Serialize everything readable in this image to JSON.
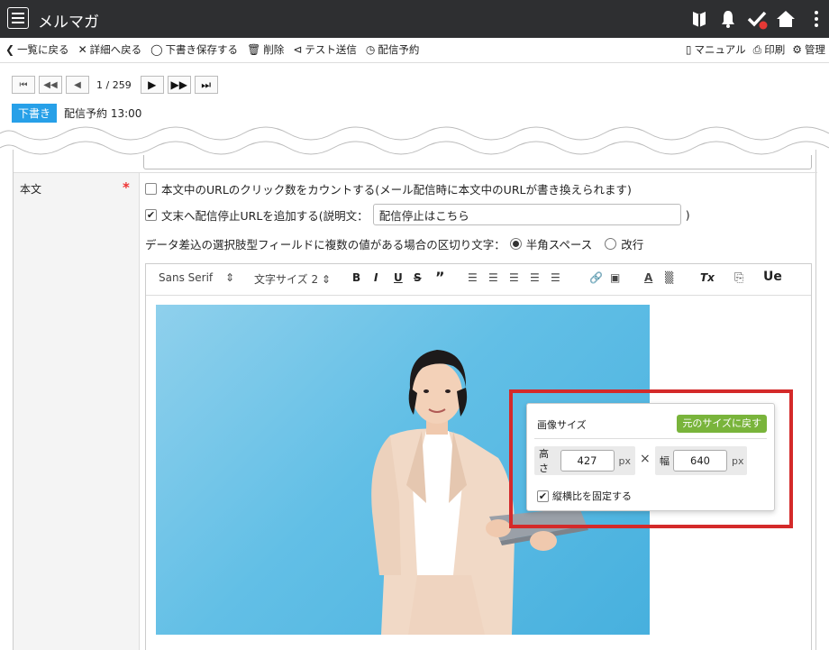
{
  "header": {
    "title": "メルマガ",
    "icons": [
      "menu-icon",
      "bookmark-icon",
      "bell-icon",
      "check-icon",
      "home-icon",
      "more-icon"
    ],
    "check_dot_color": "#e53935"
  },
  "toolbar": {
    "back_list": "一覧に戻る",
    "back_detail": "詳細へ戻る",
    "save_draft": "下書き保存する",
    "delete": "削除",
    "test_send": "テスト送信",
    "schedule": "配信予約",
    "manual": "マニュアル",
    "print": "印刷",
    "admin": "管理"
  },
  "pager": {
    "count": "1 / 259"
  },
  "status": {
    "badge": "下書き",
    "schedule": "配信予約 13:00",
    "badge_color": "#27a0e8"
  },
  "form": {
    "body_label": "本文",
    "required_mark": "*",
    "count_clicks_label": "本文中のURLのクリック数をカウントする(メール配信時に本文中のURLが書き換えられます)",
    "count_clicks_checked": false,
    "add_unsub_label": "文末へ配信停止URLを追加する(説明文：",
    "add_unsub_checked": true,
    "unsub_text": "配信停止はこちら",
    "unsub_close": ")",
    "delimiter_label": "データ差込の選択肢型フィールドに複数の値がある場合の区切り文字：",
    "delimiter_options": [
      {
        "label": "半角スペース",
        "selected": true
      },
      {
        "label": "改行",
        "selected": false
      }
    ]
  },
  "editor_toolbar": {
    "font": "Sans Serif",
    "font_arrow": "⇕",
    "size": "文字サイズ 2",
    "size_arrow": "⇕",
    "bold": "B",
    "italic": "I",
    "underline": "U",
    "strike": "S",
    "quote": "”",
    "clean": "Tx",
    "source": "Ue"
  },
  "image_popup": {
    "title": "画像サイズ",
    "reset": "元のサイズに戻す",
    "height_label": "高さ",
    "height_value": "427",
    "height_unit": "px",
    "times": "×",
    "width_label": "幅",
    "width_value": "640",
    "width_unit": "px",
    "lock_label": "縦横比を固定する",
    "lock_checked": true,
    "reset_color": "#79b43b",
    "highlight_color": "#d42a2a"
  }
}
